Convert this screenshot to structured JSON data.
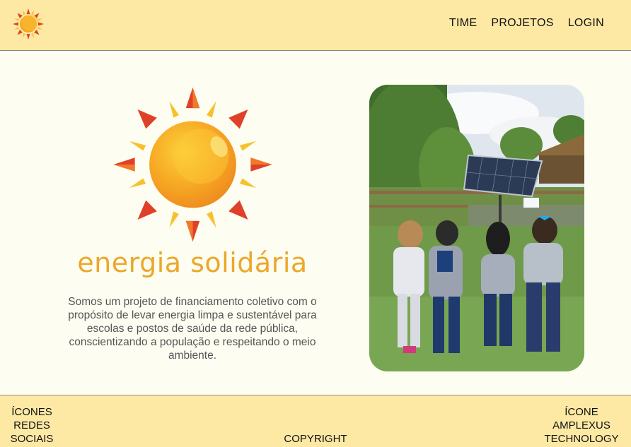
{
  "header": {
    "nav": [
      {
        "label": "TIME"
      },
      {
        "label": "PROJETOS"
      },
      {
        "label": "LOGIN"
      }
    ]
  },
  "hero": {
    "brand": "energia solidária",
    "description": "Somos um projeto de financiamento coletivo com o propósito de levar energia limpa e sustentável para escolas e postos de saúde da rede pública, conscientizando a população e respeitando o meio ambiente.",
    "photo_icon": "children-solar-panel-photo"
  },
  "footer": {
    "left": "ÍCONES\nREDES\nSOCIAIS",
    "center": "COPYRIGHT",
    "right": "ÍCONE\nAMPLEXUS\nTECHNOLOGY"
  },
  "colors": {
    "header_bg": "#fde9a4",
    "page_bg": "#fdfdf1",
    "brand": "#eba82a"
  }
}
